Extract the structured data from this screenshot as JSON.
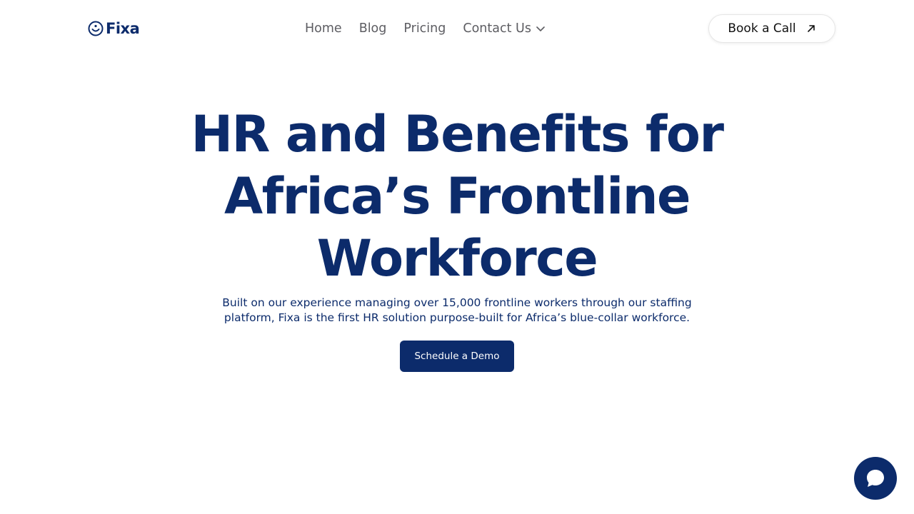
{
  "header": {
    "logo_text": "Fixa",
    "nav": {
      "home": "Home",
      "blog": "Blog",
      "pricing": "Pricing",
      "contact": "Contact Us"
    },
    "book_call": "Book a Call"
  },
  "hero": {
    "title": "HR and Benefits for Africa’s Frontline Workforce",
    "subtitle": "Built on our experience managing over 15,000 frontline workers through our staffing platform, Fixa is the first HR solution purpose-built for Africa’s blue-collar workforce.",
    "cta": "Schedule a Demo"
  },
  "icons": {
    "logo": "smiley-face-icon",
    "contact_dropdown": "chevron-down-icon",
    "book_call": "arrow-up-right-icon",
    "chat": "chat-bubble-icon"
  },
  "colors": {
    "brand": "#0c2b6b",
    "nav_text": "#5d5d62",
    "background": "#ffffff"
  }
}
